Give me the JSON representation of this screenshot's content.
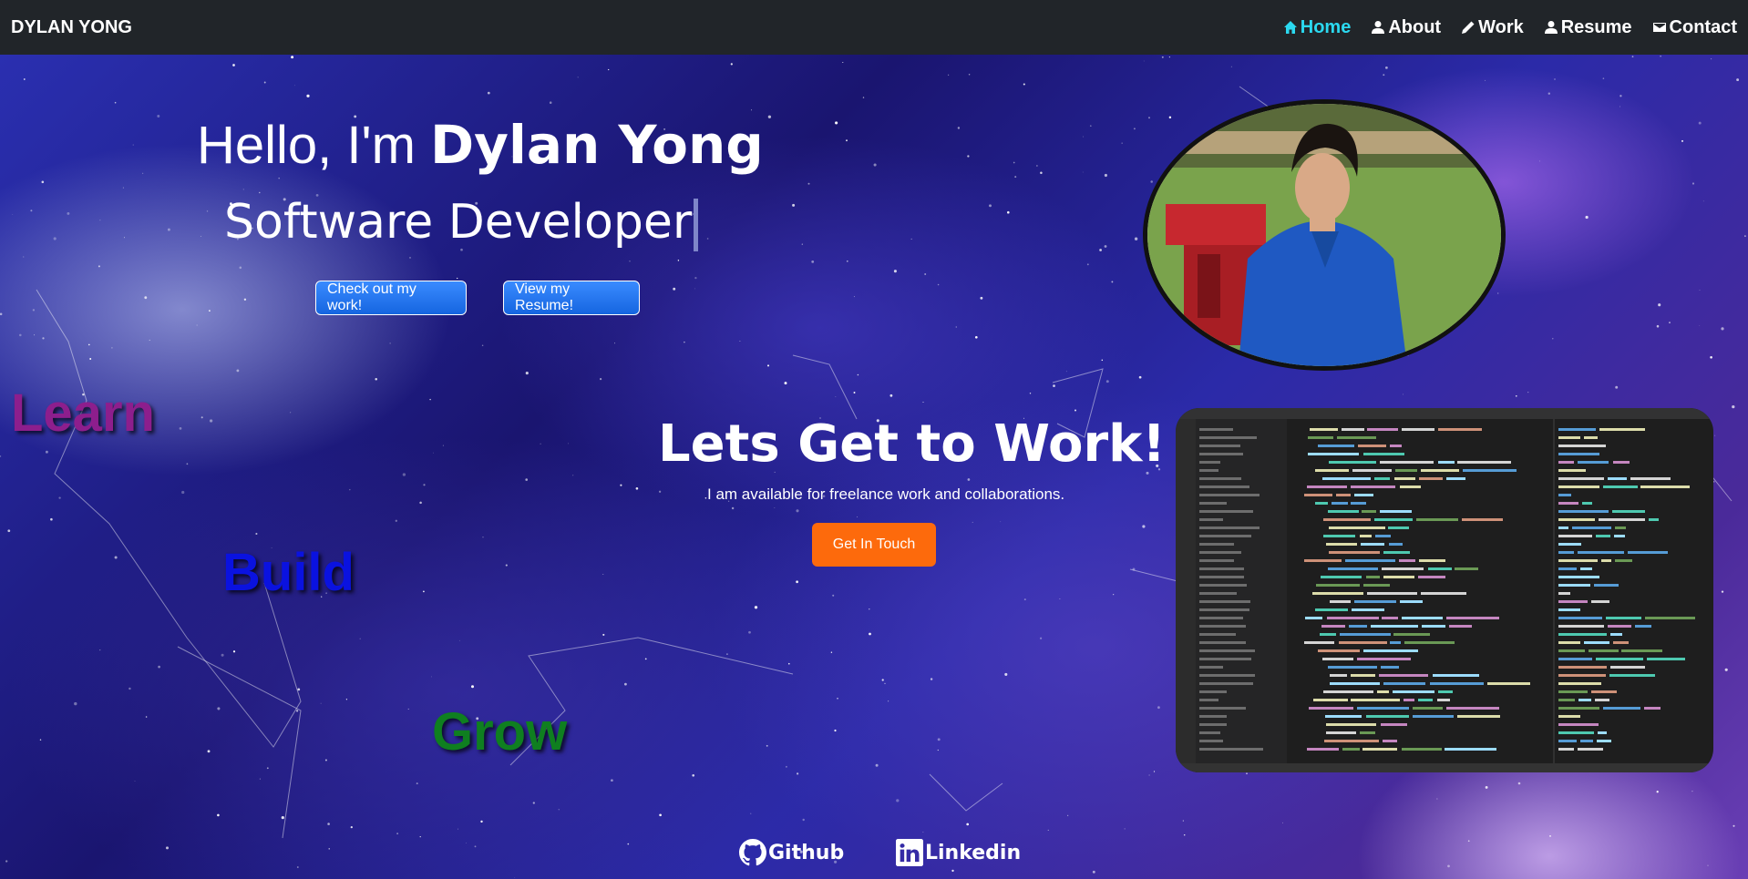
{
  "nav": {
    "brand": "DYLAN YONG",
    "items": [
      {
        "label": "Home",
        "icon": "home-icon",
        "active": true
      },
      {
        "label": "About",
        "icon": "person-icon"
      },
      {
        "label": "Work",
        "icon": "pencil-icon"
      },
      {
        "label": "Resume",
        "icon": "person-icon"
      },
      {
        "label": "Contact",
        "icon": "mail-icon"
      }
    ],
    "active_color": "#2bd9f0"
  },
  "hero": {
    "greeting": "Hello, I'm ",
    "name": "Dylan Yong",
    "role": "Software Developer",
    "work_button": "Check out my work!",
    "resume_button": "View my Resume!"
  },
  "stacked_words": {
    "learn": "Learn",
    "build": "Build",
    "grow": "Grow",
    "colors": {
      "learn": "#8d1e8d",
      "build": "#0a12e0",
      "grow": "#0f7f20"
    }
  },
  "cta": {
    "title": "Lets Get to Work!",
    "subtitle": "I am available for freelance work and collaborations.",
    "button": "Get In Touch",
    "button_color": "#fd6a0c"
  },
  "social": {
    "github": "Github",
    "linkedin": "Linkedin"
  }
}
